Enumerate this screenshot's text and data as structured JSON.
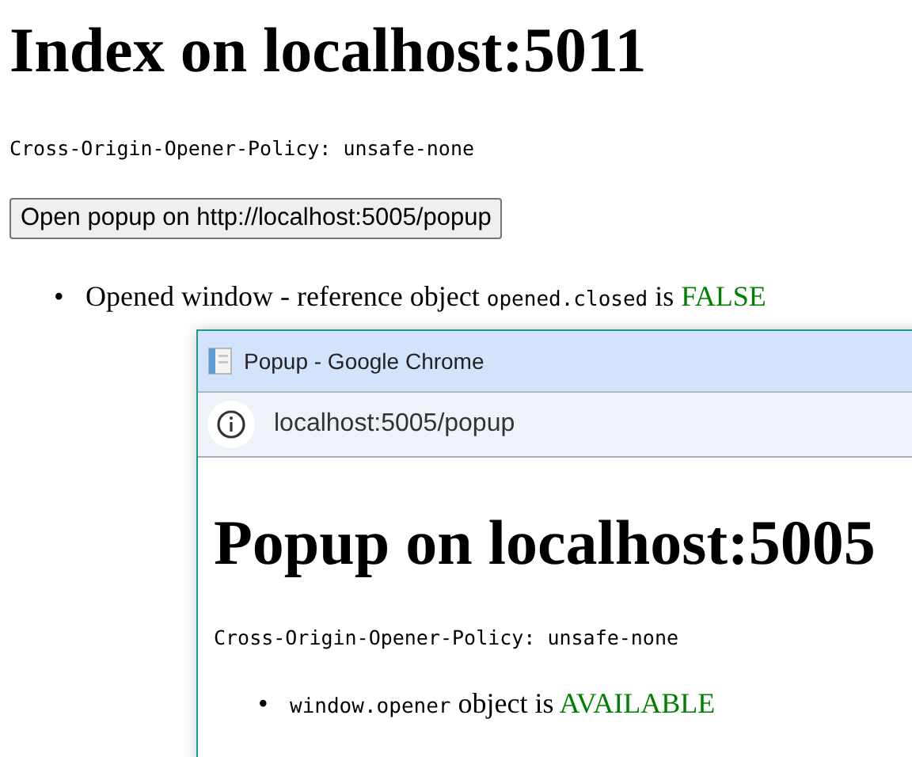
{
  "page": {
    "heading": "Index on localhost:5011",
    "policy": "Cross-Origin-Opener-Policy: unsafe-none",
    "button": "Open popup on http://localhost:5005/popup",
    "items": [
      {
        "bullet": "•",
        "parts": [
          {
            "kind": "text",
            "text": "Opened window - reference object "
          },
          {
            "kind": "code",
            "text": "opened.closed"
          },
          {
            "kind": "text",
            "text": " is "
          },
          {
            "kind": "status",
            "text": "FALSE"
          }
        ]
      }
    ]
  },
  "popup": {
    "window_title": "Popup - Google Chrome",
    "address": "localhost:5005/popup",
    "heading": "Popup on localhost:5005",
    "policy": "Cross-Origin-Opener-Policy: unsafe-none",
    "items": [
      {
        "bullet": "•",
        "parts": [
          {
            "kind": "code",
            "text": "window.opener"
          },
          {
            "kind": "text",
            "text": " object is "
          },
          {
            "kind": "status",
            "text": "AVAILABLE"
          }
        ]
      }
    ]
  }
}
